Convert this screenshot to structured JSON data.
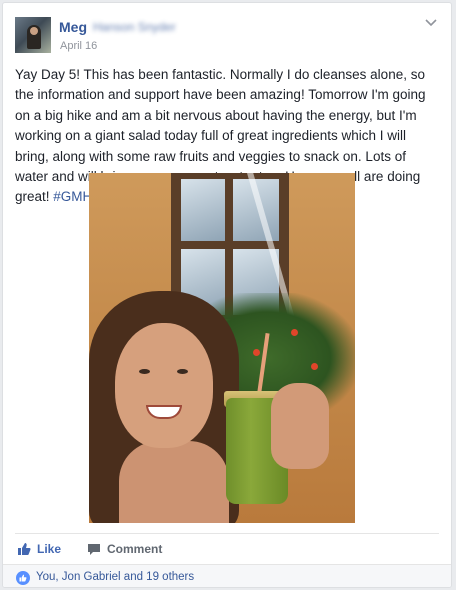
{
  "post": {
    "author_first": "Meg",
    "author_last_blurred": "Hanson Snyder",
    "date": "April 16",
    "body": "Yay Day 5! This has been fantastic. Normally I do cleanses alone, so the information and support have been amazing! Tomorrow I'm going on a big hike and am a bit nervous about having the energy, but I'm working on a giant salad today full of great ingredients which I will bring, along with some raw fruits and veggies to snack on. Lots of water and will bring some coconut water too. Hope you all are doing great! ",
    "hashtag": "#GMHealthySelfie"
  },
  "actions": {
    "like_label": "Like",
    "comment_label": "Comment"
  },
  "reactions": {
    "text": "You, Jon Gabriel and 19 others"
  },
  "icons": {
    "menu": "chevron-down-icon",
    "like": "thumbs-up-icon",
    "comment": "speech-bubble-icon",
    "reaction": "like-reaction-icon"
  },
  "colors": {
    "link": "#365899",
    "meta": "#90949c",
    "text": "#1d2129",
    "action_text": "#606770",
    "like_accent": "#4267b2",
    "reaction_blue": "#5890ff"
  }
}
